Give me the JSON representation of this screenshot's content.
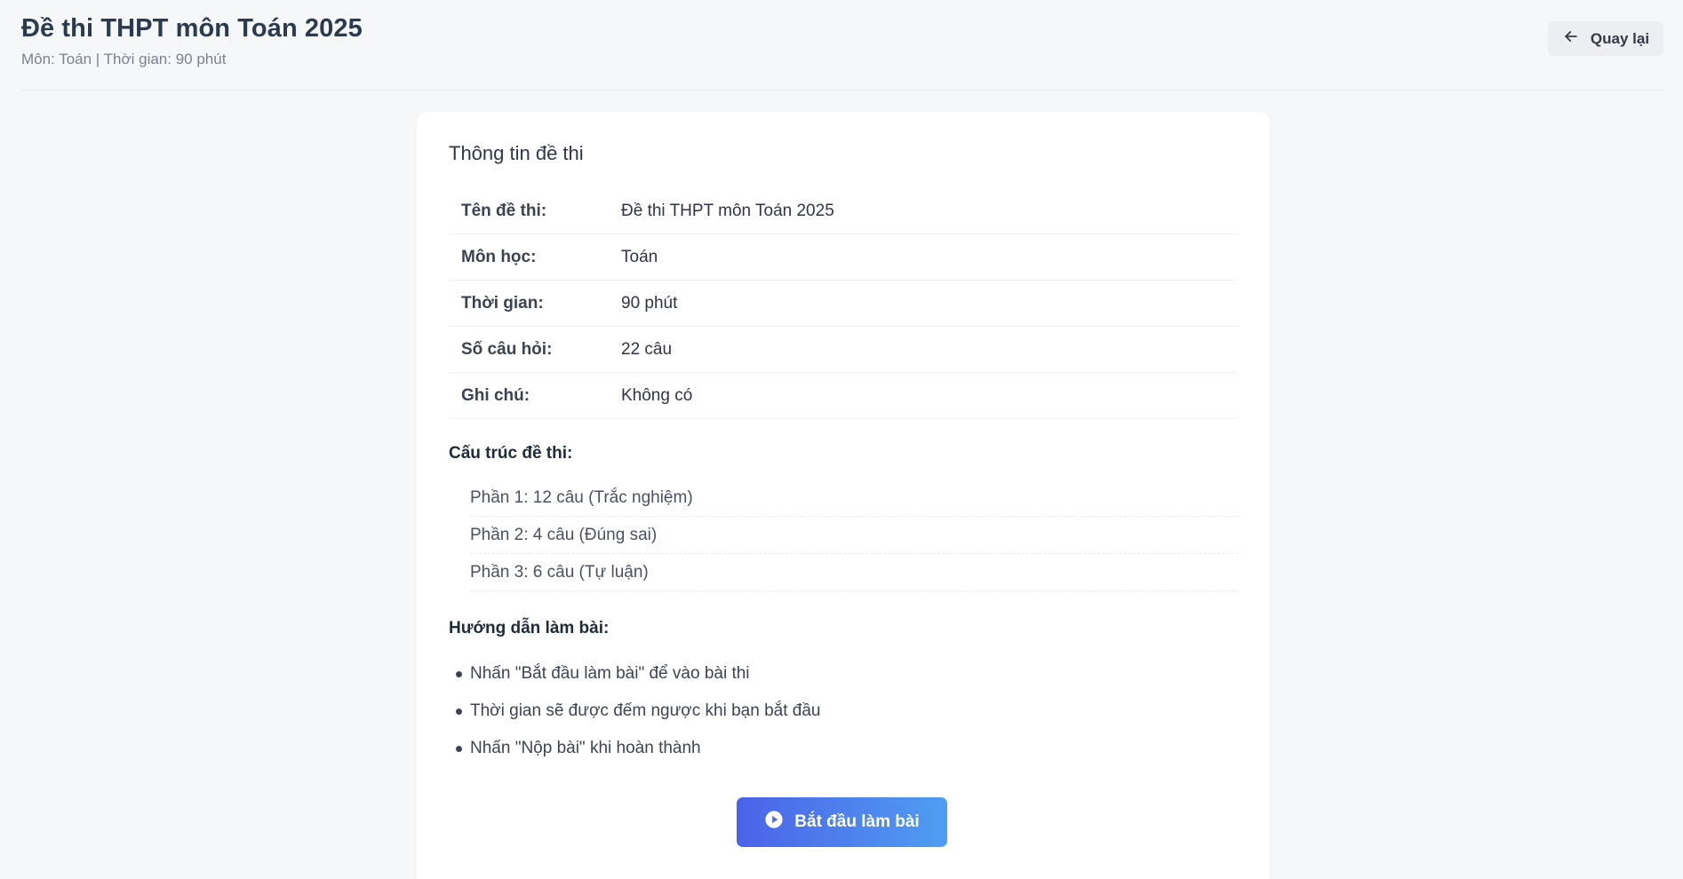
{
  "header": {
    "title": "Đề thi THPT môn Toán 2025",
    "subtitle": "Môn: Toán | Thời gian: 90 phút",
    "back_label": "Quay lại",
    "back_icon": "arrow-left-icon"
  },
  "card": {
    "title": "Thông tin đề thi",
    "info": [
      {
        "label": "Tên đề thi:",
        "value": "Đề thi THPT môn Toán 2025"
      },
      {
        "label": "Môn học:",
        "value": "Toán"
      },
      {
        "label": "Thời gian:",
        "value": "90 phút"
      },
      {
        "label": "Số câu hỏi:",
        "value": "22 câu"
      },
      {
        "label": "Ghi chú:",
        "value": "Không có"
      }
    ],
    "structure_heading": "Cấu trúc đề thi:",
    "structure": [
      "Phần 1: 12 câu (Trắc nghiệm)",
      "Phần 2: 4 câu (Đúng sai)",
      "Phần 3: 6 câu (Tự luận)"
    ],
    "guide_heading": "Hướng dẫn làm bài:",
    "guide": [
      "Nhấn \"Bắt đầu làm bài\" để vào bài thi",
      "Thời gian sẽ được đếm ngược khi bạn bắt đầu",
      "Nhấn \"Nộp bài\" khi hoàn thành"
    ],
    "start_label": "Bắt đầu làm bài",
    "start_icon": "play-circle-icon"
  },
  "colors": {
    "accent_start": "#4b62e8",
    "accent_end": "#4f9ef2",
    "background": "#f6f7f9"
  }
}
